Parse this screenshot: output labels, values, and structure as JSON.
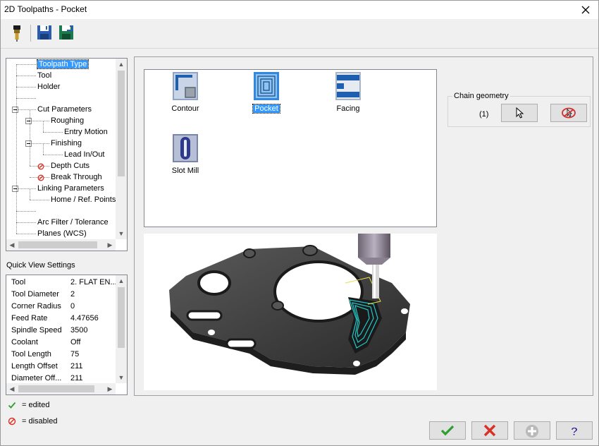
{
  "window": {
    "title": "2D Toolpaths - Pocket"
  },
  "toolbar": {
    "icons": [
      "tool-probe-icon",
      "save-icon",
      "save-as-icon"
    ]
  },
  "tree": {
    "items": [
      {
        "label": "Toolpath Type",
        "level": 0,
        "selected": true
      },
      {
        "label": "Tool",
        "level": 0
      },
      {
        "label": "Holder",
        "level": 0
      },
      {
        "label": "",
        "level": 0
      },
      {
        "label": "Cut Parameters",
        "level": 0,
        "expanded": true
      },
      {
        "label": "Roughing",
        "level": 1,
        "expanded": true
      },
      {
        "label": "Entry Motion",
        "level": 2
      },
      {
        "label": "Finishing",
        "level": 1,
        "expanded": true
      },
      {
        "label": "Lead In/Out",
        "level": 2
      },
      {
        "label": "Depth Cuts",
        "level": 1,
        "disabled": true
      },
      {
        "label": "Break Through",
        "level": 1,
        "disabled": true
      },
      {
        "label": "Linking Parameters",
        "level": 0,
        "expanded": true
      },
      {
        "label": "Home / Ref. Points",
        "level": 1
      },
      {
        "label": "",
        "level": 0
      },
      {
        "label": "Arc Filter / Tolerance",
        "level": 0
      },
      {
        "label": "Planes (WCS)",
        "level": 0
      }
    ]
  },
  "quick_view": {
    "title": "Quick View Settings",
    "rows": [
      {
        "key": "Tool",
        "value": "2. FLAT EN..."
      },
      {
        "key": "Tool Diameter",
        "value": "2"
      },
      {
        "key": "Corner Radius",
        "value": "0"
      },
      {
        "key": "Feed Rate",
        "value": "4.47656"
      },
      {
        "key": "Spindle Speed",
        "value": "3500"
      },
      {
        "key": "Coolant",
        "value": "Off"
      },
      {
        "key": "Tool Length",
        "value": "75"
      },
      {
        "key": "Length Offset",
        "value": "211"
      },
      {
        "key": "Diameter Off...",
        "value": "211"
      }
    ]
  },
  "legend": {
    "edited": "= edited",
    "disabled": "= disabled"
  },
  "toolpath_types": [
    {
      "label": "Contour",
      "icon": "contour-icon"
    },
    {
      "label": "Pocket",
      "icon": "pocket-icon",
      "selected": true
    },
    {
      "label": "Facing",
      "icon": "facing-icon"
    },
    {
      "label": "Slot Mill",
      "icon": "slot-mill-icon"
    }
  ],
  "chain_geometry": {
    "caption": "Chain geometry",
    "count": "(1)"
  },
  "colors": {
    "selection": "#3399ff",
    "ok_green": "#2e9e2e",
    "cancel_red": "#d93025",
    "part_gray": "#3c3c3c",
    "toolpath_cyan": "#22c7c7"
  }
}
